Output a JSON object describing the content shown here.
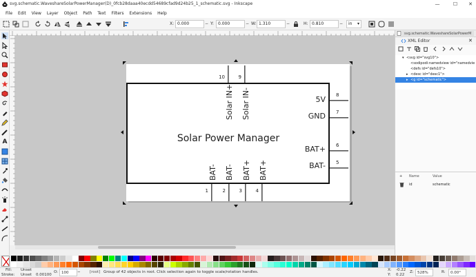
{
  "window": {
    "title": "svg.schematic.WaveshareSolarPowerManager(D)_0fcb28daaa40ecdd54689cfad9d24b25_1_schematic.svg - Inkscape"
  },
  "menu": [
    "File",
    "Edit",
    "View",
    "Layer",
    "Object",
    "Path",
    "Text",
    "Filters",
    "Extensions",
    "Help"
  ],
  "toolbar": {
    "x_label": "X:",
    "x_value": "0.000",
    "y_label": "Y:",
    "y_value": "0.000",
    "w_label": "W:",
    "w_value": "1.310",
    "h_label": "H:",
    "h_value": "0.810",
    "unit": "in",
    "unit_arrow": "▾"
  },
  "schematic": {
    "title": "Solar Power Manager",
    "top_pins": [
      {
        "num": "10",
        "label": "Solar IN+"
      },
      {
        "num": "9",
        "label": "Solar IN-"
      }
    ],
    "right_pins": [
      {
        "num": "8",
        "label": "5V"
      },
      {
        "num": "7",
        "label": "GND"
      },
      {
        "num": "6",
        "label": "BAT+"
      },
      {
        "num": "5",
        "label": "BAT-"
      }
    ],
    "bottom_pins": [
      {
        "num": "1",
        "label": "BAT-"
      },
      {
        "num": "2",
        "label": "BAT-"
      },
      {
        "num": "3",
        "label": "BAT+"
      },
      {
        "num": "4",
        "label": "BAT+"
      }
    ]
  },
  "panel": {
    "tab_title": "svg.schematic.WaveshareSolarPowerM",
    "header": "XML Editor",
    "tree": [
      {
        "indent": 0,
        "arrow": "▾",
        "text": "<svg id=\"svg10\">",
        "selected": false
      },
      {
        "indent": 1,
        "arrow": "",
        "text": "<sodipodi:namedview id=\"namedvie",
        "selected": false
      },
      {
        "indent": 1,
        "arrow": "",
        "text": "<defs id=\"defs10\">",
        "selected": false
      },
      {
        "indent": 1,
        "arrow": "▸",
        "text": "<desc id=\"desc1\">",
        "selected": false
      },
      {
        "indent": 1,
        "arrow": "▸",
        "text": "<g id=\"schematic\">",
        "selected": true
      }
    ],
    "attr_name_header": "Name",
    "attr_value_header": "Value",
    "attr_plus": "+",
    "attr_name": "id",
    "attr_value": "schematic"
  },
  "status": {
    "fill_label": "Fill:",
    "fill_value": "Unset",
    "stroke_label": "Stroke:",
    "stroke_value": "Unset",
    "stroke_width": "0.00100",
    "opacity_label": "O:",
    "opacity_value": "100",
    "layer": "[root]",
    "message": "Group of 42 objects in root. Click selection again to toggle scale/rotation handles.",
    "x_label": "X:",
    "x_coord": "-0.22",
    "y_label": "Y:",
    "y_coord": "0.22",
    "zoom_label": "Z:",
    "zoom": "528%",
    "rotate_label": "R:",
    "rotation": "0.00°"
  },
  "palette": {
    "row1": [
      "#000000",
      "#1a1a1a",
      "#333333",
      "#4d4d4d",
      "#666666",
      "#808080",
      "#999999",
      "#b3b3b3",
      "#cccccc",
      "#e6e6e6",
      "#ffffff",
      "#800000",
      "#ff0000",
      "#808000",
      "#ffff00",
      "#008000",
      "#00ff00",
      "#008080",
      "#00ffff",
      "#000080",
      "#0000ff",
      "#800080",
      "#ff00ff",
      "#2b0000",
      "#550000",
      "#800000",
      "#aa0000",
      "#d40000",
      "#ff2a2a",
      "#ff5555",
      "#ff8080",
      "#ffaaaa",
      "#ffd5d5",
      "#280b0b",
      "#501616",
      "#782121",
      "#a02c2c",
      "#c83737",
      "#d35f5f",
      "#de8787",
      "#e9afaf",
      "#f4d7d7",
      "#241c1c",
      "#483737",
      "#6c5353",
      "#916f6f",
      "#ac9393",
      "#c8b7b7",
      "#e3dbdb",
      "#2b1100",
      "#552200",
      "#803300",
      "#aa4400",
      "#d45500",
      "#ff6600",
      "#ff7f2a",
      "#ff9955",
      "#ffb380",
      "#ffccaa",
      "#ffe6d5",
      "#28170b",
      "#502d16",
      "#784421",
      "#a05a2c",
      "#c87137",
      "#d38d5f",
      "#deaa87",
      "#e9c6af",
      "#f4e3d7",
      "#241f1c",
      "#483e37",
      "#6c5d53",
      "#917c6f",
      "#ac9d93",
      "#c8beb7",
      "#e3dedb"
    ],
    "row2": [
      "#ffffff",
      "#f2f2f2",
      "#e6e6e6",
      "#d9d9d9",
      "#cccccc",
      "#ffccaa",
      "#ffb380",
      "#ff9955",
      "#ff7f2a",
      "#ff6600",
      "#d45500",
      "#aa4400",
      "#803300",
      "#552200",
      "#2b1100",
      "#ffeeaa",
      "#ffe680",
      "#ffdd55",
      "#ffd42a",
      "#ffcc00",
      "#d4aa00",
      "#aa8800",
      "#806600",
      "#554400",
      "#2b2200",
      "#e5ff80",
      "#ccff00",
      "#aad400",
      "#88aa00",
      "#668000",
      "#445500",
      "#d7f4d7",
      "#afe9af",
      "#87de87",
      "#5fd35f",
      "#37c837",
      "#2ca02c",
      "#217821",
      "#165016",
      "#0b280b",
      "#d5fff6",
      "#aaffee",
      "#80ffe6",
      "#55ffdd",
      "#2affd5",
      "#00ffcc",
      "#00d4aa",
      "#00aa88",
      "#008066",
      "#005544",
      "#d5f6ff",
      "#aaeeff",
      "#80e5ff",
      "#55ddff",
      "#2ad4ff",
      "#00ccff",
      "#00aad4",
      "#0088aa",
      "#006680",
      "#004455",
      "#d5e5ff",
      "#aaccff",
      "#80b3ff",
      "#5599ff",
      "#2a7fff",
      "#0066ff",
      "#0055d4",
      "#0044aa",
      "#003380",
      "#002255",
      "#e5d5ff",
      "#ccaaff",
      "#b380ff",
      "#9955ff",
      "#7f2aff",
      "#6600ff"
    ]
  },
  "colors": {
    "selection": "#3584e4",
    "canvas": "#c8c8c8",
    "page": "#ffffff"
  }
}
